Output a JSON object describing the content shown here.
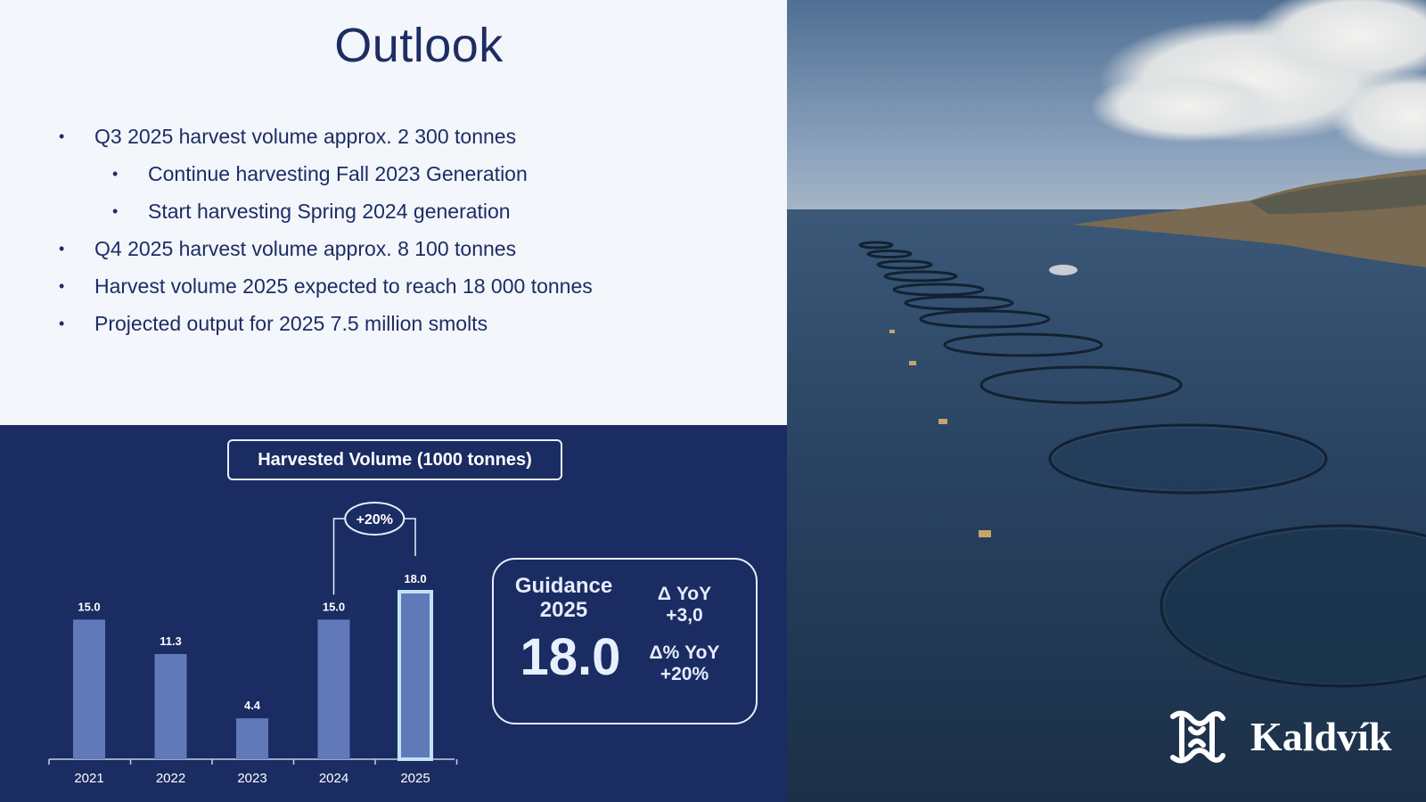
{
  "slide": {
    "title": "Outlook",
    "bullets": [
      {
        "level": 1,
        "text": "Q3 2025 harvest volume approx. 2 300 tonnes"
      },
      {
        "level": 2,
        "text": "Continue harvesting Fall 2023 Generation"
      },
      {
        "level": 2,
        "text": "Start harvesting Spring 2024 generation"
      },
      {
        "level": 1,
        "text": "Q4 2025 harvest volume approx. 8 100 tonnes"
      },
      {
        "level": 1,
        "text": "Harvest volume 2025 expected to reach 18 000 tonnes"
      },
      {
        "level": 1,
        "text": "Projected output for 2025 7.5 million smolts"
      }
    ],
    "bullet_symbol": "•"
  },
  "guidance": {
    "label_line1": "Guidance",
    "label_line2": "2025",
    "value": "18.0",
    "delta_abs_label": "Δ YoY",
    "delta_abs_value": "+3,0",
    "delta_pct_label": "Δ% YoY",
    "delta_pct_value": "+20%"
  },
  "brand": {
    "name": "Kaldvík"
  },
  "colors": {
    "navy": "#1b2c63",
    "bar": "#6279b9",
    "bar_highlight_border": "#bfe5f5",
    "text_dark": "#1d2d64",
    "panel_light": "#f3f6fb"
  },
  "chart_data": {
    "type": "bar",
    "title": "Harvested Volume (1000 tonnes)",
    "categories": [
      "2021",
      "2022",
      "2023",
      "2024",
      "2025"
    ],
    "values": [
      15.0,
      11.3,
      4.4,
      15.0,
      18.0
    ],
    "value_labels": [
      "15.0",
      "11.3",
      "4.4",
      "15.0",
      "18.0"
    ],
    "highlight_index": 4,
    "annotation": {
      "text": "+20%",
      "from_index": 3,
      "to_index": 4
    },
    "ylim": [
      0,
      18.0
    ],
    "grid": false,
    "legend": "none"
  }
}
